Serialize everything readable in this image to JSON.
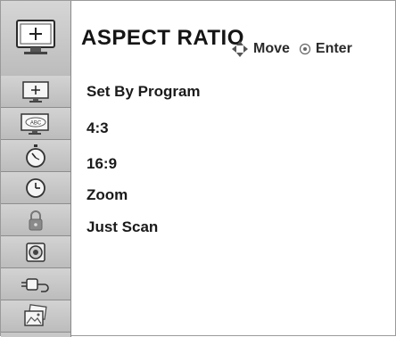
{
  "header": {
    "title": "ASPECT RATIO",
    "hint_move": "Move",
    "hint_enter": "Enter",
    "icon": "picture-screen-icon"
  },
  "sidebar": {
    "items": [
      {
        "icon": "picture-screen-icon"
      },
      {
        "icon": "abc-screen-icon"
      },
      {
        "icon": "stopwatch-icon"
      },
      {
        "icon": "clock-icon"
      },
      {
        "icon": "padlock-icon"
      },
      {
        "icon": "speaker-icon"
      },
      {
        "icon": "plug-connector-icon"
      },
      {
        "icon": "photo-media-icon"
      }
    ]
  },
  "options": [
    {
      "label": "Set By Program"
    },
    {
      "label": "4:3"
    },
    {
      "label": "16:9"
    },
    {
      "label": "Zoom"
    },
    {
      "label": "Just Scan"
    }
  ]
}
